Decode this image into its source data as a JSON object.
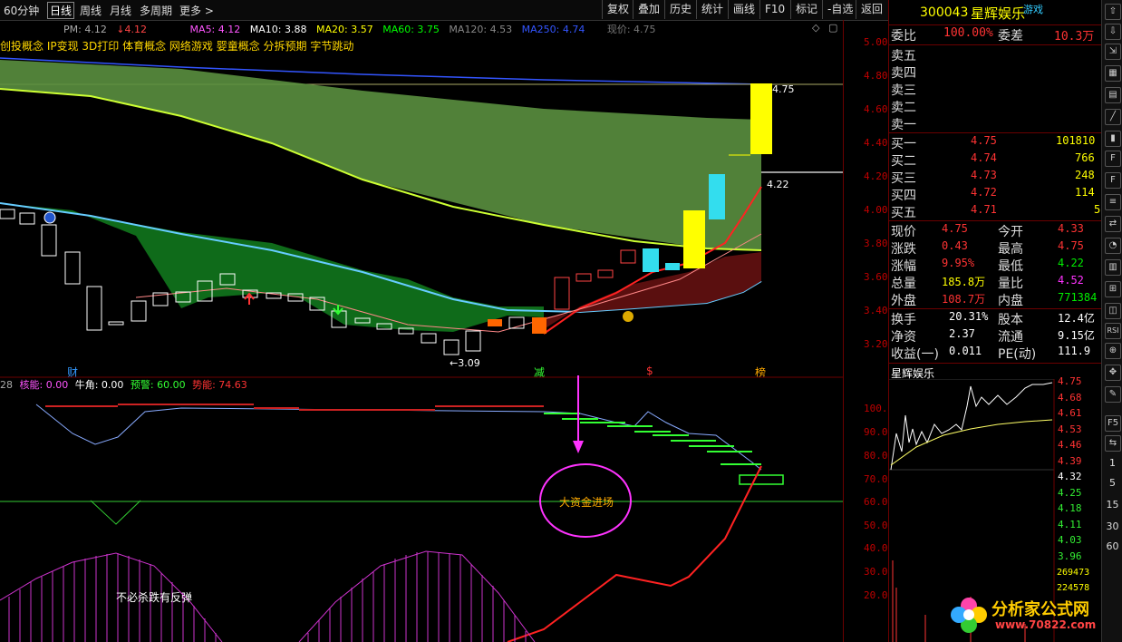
{
  "toolbar": {
    "periods": [
      "60分钟",
      "日线",
      "周线",
      "月线",
      "多周期",
      "更多"
    ],
    "active_period": "日线",
    "buttons": [
      "复权",
      "叠加",
      "历史",
      "统计",
      "画线",
      "F10",
      "标记",
      "-自选",
      "返回"
    ]
  },
  "ma_line": {
    "pm": "PM: 4.12",
    "pm_val": "4.12",
    "ma5": "MA5: 4.12",
    "ma10": "MA10: 3.88",
    "ma20": "MA20: 3.57",
    "ma60": "MA60: 3.75",
    "ma120": "MA120: 4.53",
    "ma250": "MA250: 4.74",
    "current_price": "现价: 4.75",
    "colors": {
      "ma5": "#ff55ff",
      "ma10": "#ffffff",
      "ma20": "#ffff00",
      "ma60": "#00ff00",
      "ma120": "#888888",
      "ma250": "#3355ff"
    }
  },
  "concepts": "创投概念 IP变现 3D打印 体育概念 网络游戏 婴童概念 分拆预期 字节跳动",
  "price_axis": [
    "5.00",
    "4.80",
    "4.60",
    "4.40",
    "4.20",
    "4.00",
    "3.80",
    "3.60",
    "3.40",
    "3.20"
  ],
  "chart_annotations": {
    "high": "4.75",
    "high_marker": "4.22",
    "low": "3.09",
    "events": [
      "财",
      "减",
      "$",
      "榜"
    ]
  },
  "indicator_bar": {
    "prefix": "28",
    "heneng": "核能: 0.00",
    "niujiao": "牛角: 0.00",
    "yujing": "预警: 60.00",
    "shineng": "势能: 74.63"
  },
  "indicator_axis": [
    "100.0",
    "90.00",
    "80.00",
    "70.00",
    "60.00",
    "50.00",
    "40.00",
    "30.00",
    "20.00"
  ],
  "indicator_annotations": {
    "big_money": "大资金进场",
    "no_panic": "不必杀跌有反弹"
  },
  "stock": {
    "code": "300043",
    "name": "星辉娱乐",
    "tag": "游戏",
    "webi_label": "委比",
    "webi": "100.00%",
    "weicha_label": "委差",
    "weicha": "10.3万",
    "sell_levels": [
      "卖五",
      "卖四",
      "卖三",
      "卖二",
      "卖一"
    ],
    "buy_levels": [
      {
        "label": "买一",
        "price": "4.75",
        "vol": "101810"
      },
      {
        "label": "买二",
        "price": "4.74",
        "vol": "766"
      },
      {
        "label": "买三",
        "price": "4.73",
        "vol": "248"
      },
      {
        "label": "买四",
        "price": "4.72",
        "vol": "114"
      },
      {
        "label": "买五",
        "price": "4.71",
        "vol": "5"
      }
    ],
    "stats": [
      {
        "k1": "现价",
        "v1": "4.75",
        "c1": "#ff3333",
        "k2": "今开",
        "v2": "4.33",
        "c2": "#ff3333"
      },
      {
        "k1": "涨跌",
        "v1": "0.43",
        "c1": "#ff3333",
        "k2": "最高",
        "v2": "4.75",
        "c2": "#ff3333"
      },
      {
        "k1": "涨幅",
        "v1": "9.95%",
        "c1": "#ff3333",
        "k2": "最低",
        "v2": "4.22",
        "c2": "#00ee00"
      },
      {
        "k1": "总量",
        "v1": "185.8万",
        "c1": "#ffff00",
        "k2": "量比",
        "v2": "4.52",
        "c2": "#ff33ff"
      },
      {
        "k1": "外盘",
        "v1": "108.7万",
        "c1": "#ff3333",
        "k2": "内盘",
        "v2": "771384",
        "c2": "#00ee00"
      }
    ],
    "stats2": [
      {
        "k1": "换手",
        "v1": "20.31%",
        "k2": "股本",
        "v2": "12.4亿"
      },
      {
        "k1": "净资",
        "v1": "2.37",
        "k2": "流通",
        "v2": "9.15亿"
      },
      {
        "k1": "收益(一)",
        "v1": "0.011",
        "k2": "PE(动)",
        "v2": "111.9"
      }
    ]
  },
  "mini_chart": {
    "title": "星辉娱乐",
    "axis": [
      "4.75",
      "4.68",
      "4.61",
      "4.53",
      "4.46",
      "4.39",
      "4.32",
      "4.25",
      "4.18",
      "4.11",
      "4.03",
      "3.96"
    ],
    "vol_labels": [
      "269473",
      "224578"
    ]
  },
  "right_toolbar_numbers": [
    "1",
    "5",
    "15",
    "30",
    "60"
  ],
  "watermark": "分析家公式网 www.70822.com"
}
